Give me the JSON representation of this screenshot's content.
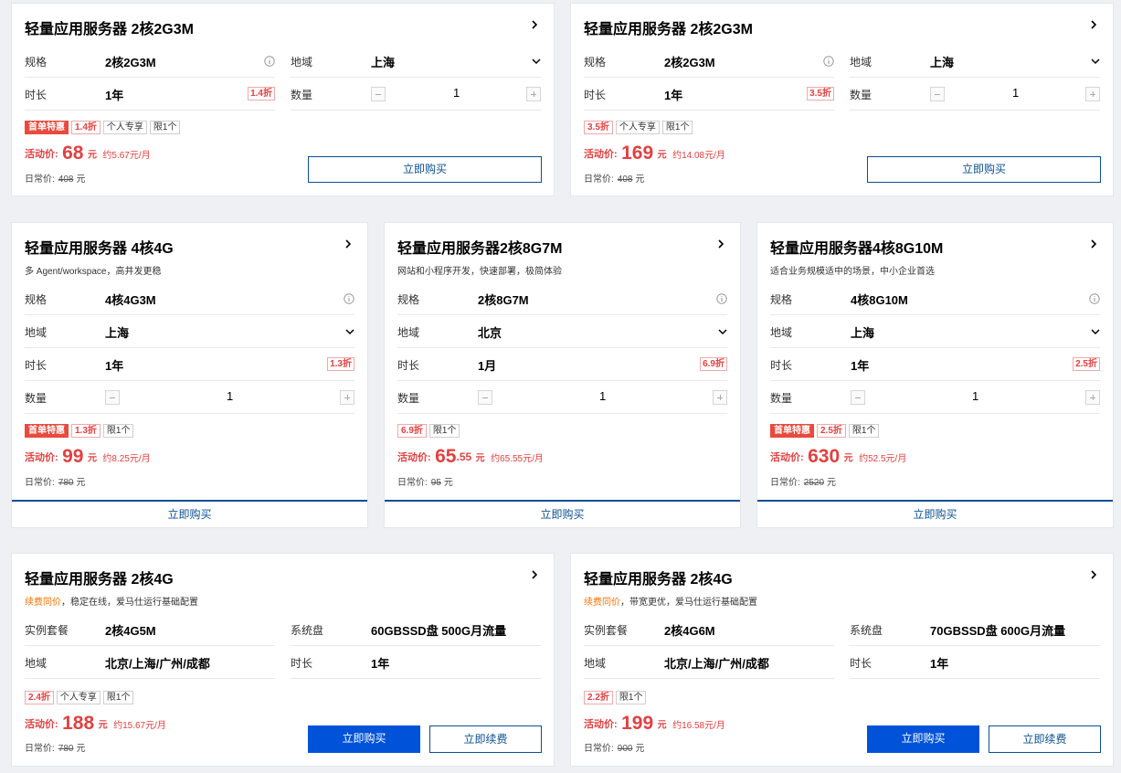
{
  "cards": [
    {
      "title": "轻量应用服务器 2核2G3M",
      "spec_label": "规格",
      "spec": "2核2G3M",
      "region_label": "地域",
      "region": "上海",
      "duration_label": "时长",
      "duration": "1年",
      "duration_discount": "1.4折",
      "qty_label": "数量",
      "qty": "1",
      "tags": [
        "首单特惠",
        "1.4折",
        "个人专享",
        "限1个"
      ],
      "price_label": "活动价:",
      "price": "68",
      "price_unit": "元",
      "monthly": "约5.67元/月",
      "orig_label": "日常价:",
      "orig": "408",
      "orig_unit": "元",
      "buy": "立即购买"
    },
    {
      "title": "轻量应用服务器 2核2G3M",
      "spec_label": "规格",
      "spec": "2核2G3M",
      "region_label": "地域",
      "region": "上海",
      "duration_label": "时长",
      "duration": "1年",
      "duration_discount": "3.5折",
      "qty_label": "数量",
      "qty": "1",
      "tags": [
        "3.5折",
        "个人专享",
        "限1个"
      ],
      "price_label": "活动价:",
      "price": "169",
      "price_unit": "元",
      "monthly": "约14.08元/月",
      "orig_label": "日常价:",
      "orig": "408",
      "orig_unit": "元",
      "buy": "立即购买"
    },
    {
      "title": "轻量应用服务器 4核4G",
      "subtitle": "多 Agent/workspace，高并发更稳",
      "spec_label": "规格",
      "spec": "4核4G3M",
      "region_label": "地域",
      "region": "上海",
      "duration_label": "时长",
      "duration": "1年",
      "duration_discount": "1.3折",
      "qty_label": "数量",
      "qty": "1",
      "tags": [
        "首单特惠",
        "1.3折",
        "限1个"
      ],
      "price_label": "活动价:",
      "price": "99",
      "price_unit": "元",
      "monthly": "约8.25元/月",
      "orig_label": "日常价:",
      "orig": "780",
      "orig_unit": "元",
      "buy": "立即购买"
    },
    {
      "title": "轻量应用服务器2核8G7M",
      "subtitle": "网站和小程序开发，快速部署，极简体验",
      "spec_label": "规格",
      "spec": "2核8G7M",
      "region_label": "地域",
      "region": "北京",
      "duration_label": "时长",
      "duration": "1月",
      "duration_discount": "6.9折",
      "qty_label": "数量",
      "qty": "1",
      "tags": [
        "6.9折",
        "限1个"
      ],
      "price_label": "活动价:",
      "price": "65",
      "price_dec": ".55",
      "price_unit": "元",
      "monthly": "约65.55元/月",
      "orig_label": "日常价:",
      "orig": "95",
      "orig_unit": "元",
      "buy": "立即购买"
    },
    {
      "title": "轻量应用服务器4核8G10M",
      "subtitle": "适合业务规模适中的场景，中小企业首选",
      "spec_label": "规格",
      "spec": "4核8G10M",
      "region_label": "地域",
      "region": "上海",
      "duration_label": "时长",
      "duration": "1年",
      "duration_discount": "2.5折",
      "qty_label": "数量",
      "qty": "1",
      "tags": [
        "首单特惠",
        "2.5折",
        "限1个"
      ],
      "price_label": "活动价:",
      "price": "630",
      "price_unit": "元",
      "monthly": "约52.5元/月",
      "orig_label": "日常价:",
      "orig": "2520",
      "orig_unit": "元",
      "buy": "立即购买"
    },
    {
      "title": "轻量应用服务器 2核4G",
      "subtitle_hl": "续费同价",
      "subtitle_rest": "，稳定在线，爱马仕运行基础配置",
      "pkg_label": "实例套餐",
      "pkg": "2核4G5M",
      "disk_label": "系统盘",
      "disk": "60GBSSD盘 500G月流量",
      "region_label": "地域",
      "region": "北京/上海/广州/成都",
      "duration_label": "时长",
      "duration": "1年",
      "tags": [
        "2.4折",
        "个人专享",
        "限1个"
      ],
      "price_label": "活动价:",
      "price": "188",
      "price_unit": "元",
      "monthly": "约15.67元/月",
      "orig_label": "日常价:",
      "orig": "780",
      "orig_unit": "元",
      "buy": "立即购买",
      "renew": "立即续费"
    },
    {
      "title": "轻量应用服务器 2核4G",
      "subtitle_hl": "续费同价",
      "subtitle_rest": "，带宽更优，爱马仕运行基础配置",
      "pkg_label": "实例套餐",
      "pkg": "2核4G6M",
      "disk_label": "系统盘",
      "disk": "70GBSSD盘 600G月流量",
      "region_label": "地域",
      "region": "北京/上海/广州/成都",
      "duration_label": "时长",
      "duration": "1年",
      "tags": [
        "2.2折",
        "限1个"
      ],
      "price_label": "活动价:",
      "price": "199",
      "price_unit": "元",
      "monthly": "约16.58元/月",
      "orig_label": "日常价:",
      "orig": "900",
      "orig_unit": "元",
      "buy": "立即购买",
      "renew": "立即续费"
    }
  ]
}
